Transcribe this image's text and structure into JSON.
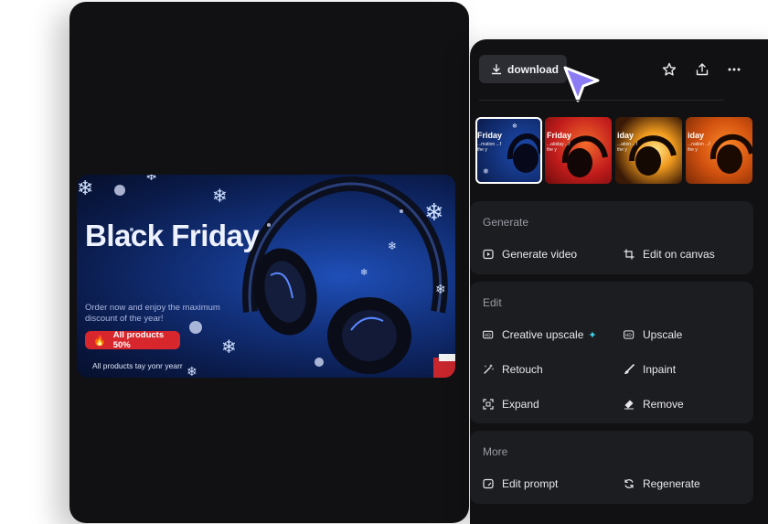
{
  "banner": {
    "title": "Black Friday",
    "subtitle": "Order now and enjoy the maximum discount of the year!",
    "badge": "All products 50%",
    "footer": "All products tay yonr yearr"
  },
  "toolbar": {
    "download_label": "download",
    "star_icon": "star-icon",
    "share_icon": "share-icon",
    "more_icon": "more-icon"
  },
  "thumbnails": [
    {
      "label": "Friday",
      "sub": "...mation ...f the y",
      "selected": true
    },
    {
      "label": "Friday",
      "sub": "...akiday ...f the y",
      "selected": false
    },
    {
      "label": "iday",
      "sub": "...ation ...f the y",
      "selected": false
    },
    {
      "label": "iday",
      "sub": "...nation ...f the y",
      "selected": false
    }
  ],
  "sections": {
    "generate": {
      "title": "Generate",
      "actions": [
        "Generate video",
        "Edit on canvas"
      ]
    },
    "edit": {
      "title": "Edit",
      "actions": [
        "Creative upscale",
        "Upscale",
        "Retouch",
        "Inpaint",
        "Expand",
        "Remove"
      ]
    },
    "more": {
      "title": "More",
      "actions": [
        "Edit prompt",
        "Regenerate"
      ]
    }
  },
  "colors": {
    "panel_bg": "#111113",
    "section_bg": "#1c1d21",
    "accent_sparkle": "#3ad4e6",
    "cursor": "#8b7cf6",
    "badge_red": "#d7262c"
  }
}
